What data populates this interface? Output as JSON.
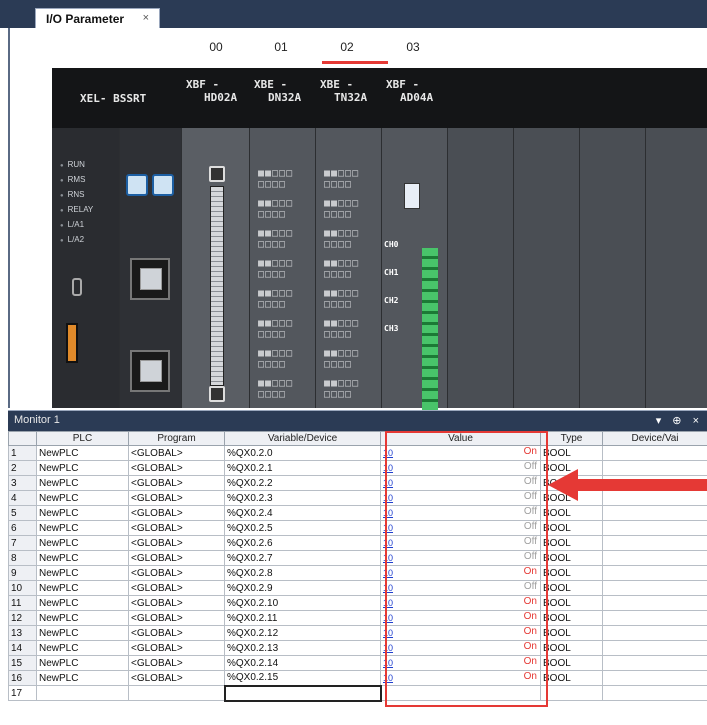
{
  "tab": {
    "title": "I/O Parameter",
    "close": "×"
  },
  "slots": [
    "00",
    "01",
    "02",
    "03"
  ],
  "rack": {
    "cpu_title": "XEL- BSSRT",
    "modules": [
      {
        "line1": "XBF -",
        "line2": "HD02A"
      },
      {
        "line1": "XBE -",
        "line2": "DN32A"
      },
      {
        "line1": "XBE -",
        "line2": "TN32A"
      },
      {
        "line1": "XBF -",
        "line2": "AD04A"
      }
    ],
    "leds": [
      "RUN",
      "RMS",
      "RNS",
      "RELAY",
      "L/A1",
      "L/A2"
    ],
    "channels": [
      "CH0",
      "CH1",
      "CH2",
      "CH3"
    ],
    "led_pattern": "■■□□□  □□□□"
  },
  "monitor": {
    "title": "Monitor 1",
    "controls": "▾ ⊕ ×",
    "columns": [
      "PLC",
      "Program",
      "Variable/Device",
      "Value",
      "Type",
      "Device/Vai"
    ],
    "rows": [
      {
        "n": "1",
        "plc": "NewPLC",
        "program": "<GLOBAL>",
        "device": "%QX0.2.0",
        "flag": "10",
        "state": "On",
        "type": "BOOL"
      },
      {
        "n": "2",
        "plc": "NewPLC",
        "program": "<GLOBAL>",
        "device": "%QX0.2.1",
        "flag": "10",
        "state": "Off",
        "type": "BOOL"
      },
      {
        "n": "3",
        "plc": "NewPLC",
        "program": "<GLOBAL>",
        "device": "%QX0.2.2",
        "flag": "10",
        "state": "Off",
        "type": "BOOL"
      },
      {
        "n": "4",
        "plc": "NewPLC",
        "program": "<GLOBAL>",
        "device": "%QX0.2.3",
        "flag": "10",
        "state": "Off",
        "type": "BOOL"
      },
      {
        "n": "5",
        "plc": "NewPLC",
        "program": "<GLOBAL>",
        "device": "%QX0.2.4",
        "flag": "10",
        "state": "Off",
        "type": "BOOL"
      },
      {
        "n": "6",
        "plc": "NewPLC",
        "program": "<GLOBAL>",
        "device": "%QX0.2.5",
        "flag": "10",
        "state": "Off",
        "type": "BOOL"
      },
      {
        "n": "7",
        "plc": "NewPLC",
        "program": "<GLOBAL>",
        "device": "%QX0.2.6",
        "flag": "10",
        "state": "Off",
        "type": "BOOL"
      },
      {
        "n": "8",
        "plc": "NewPLC",
        "program": "<GLOBAL>",
        "device": "%QX0.2.7",
        "flag": "10",
        "state": "Off",
        "type": "BOOL"
      },
      {
        "n": "9",
        "plc": "NewPLC",
        "program": "<GLOBAL>",
        "device": "%QX0.2.8",
        "flag": "10",
        "state": "On",
        "type": "BOOL"
      },
      {
        "n": "10",
        "plc": "NewPLC",
        "program": "<GLOBAL>",
        "device": "%QX0.2.9",
        "flag": "10",
        "state": "Off",
        "type": "BOOL"
      },
      {
        "n": "11",
        "plc": "NewPLC",
        "program": "<GLOBAL>",
        "device": "%QX0.2.10",
        "flag": "10",
        "state": "On",
        "type": "BOOL"
      },
      {
        "n": "12",
        "plc": "NewPLC",
        "program": "<GLOBAL>",
        "device": "%QX0.2.11",
        "flag": "10",
        "state": "On",
        "type": "BOOL"
      },
      {
        "n": "13",
        "plc": "NewPLC",
        "program": "<GLOBAL>",
        "device": "%QX0.2.12",
        "flag": "10",
        "state": "On",
        "type": "BOOL"
      },
      {
        "n": "14",
        "plc": "NewPLC",
        "program": "<GLOBAL>",
        "device": "%QX0.2.13",
        "flag": "10",
        "state": "On",
        "type": "BOOL"
      },
      {
        "n": "15",
        "plc": "NewPLC",
        "program": "<GLOBAL>",
        "device": "%QX0.2.14",
        "flag": "10",
        "state": "On",
        "type": "BOOL"
      },
      {
        "n": "16",
        "plc": "NewPLC",
        "program": "<GLOBAL>",
        "device": "%QX0.2.15",
        "flag": "10",
        "state": "On",
        "type": "BOOL"
      }
    ],
    "empty_row_n": "17"
  },
  "colors": {
    "highlight": "#e53935",
    "on": "#e53935",
    "off": "#a0a0a0",
    "titlebar": "#2b3b55"
  }
}
